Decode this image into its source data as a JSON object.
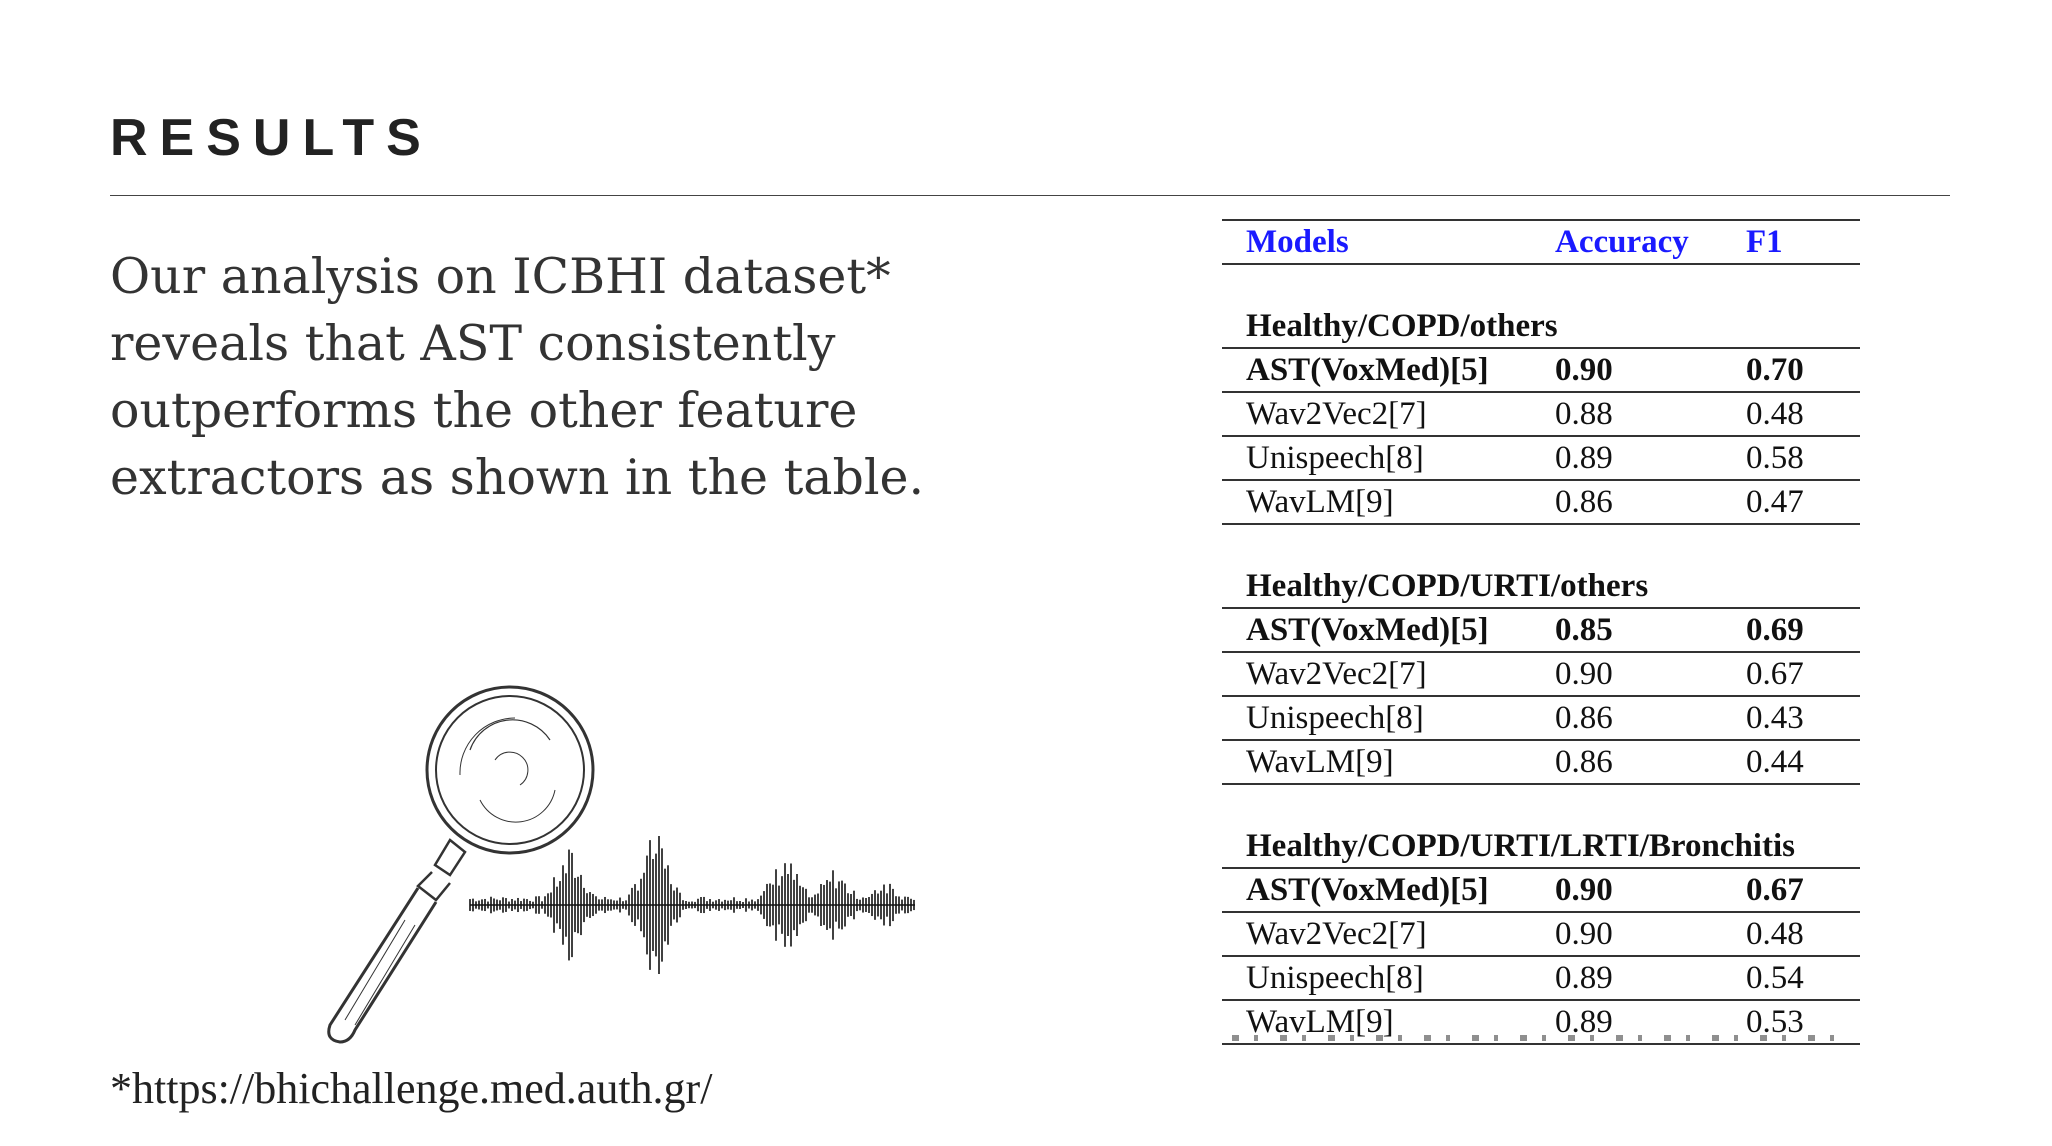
{
  "slide": {
    "title": "RESULTS",
    "body": "Our analysis on ICBHI dataset* reveals that AST consistently outperforms the other feature extractors as shown in the table.",
    "footnote": "*https://bhichallenge.med.auth.gr/"
  },
  "table": {
    "headers": [
      "Models",
      "Accuracy",
      "F1"
    ],
    "header_color": "#1a1aff",
    "groups": [
      {
        "label": "Healthy/COPD/others",
        "rows": [
          {
            "model": "AST(VoxMed)[5]",
            "accuracy": "0.90",
            "f1": "0.70",
            "best": true
          },
          {
            "model": "Wav2Vec2[7]",
            "accuracy": "0.88",
            "f1": "0.48",
            "best": false
          },
          {
            "model": "Unispeech[8]",
            "accuracy": "0.89",
            "f1": "0.58",
            "best": false
          },
          {
            "model": "WavLM[9]",
            "accuracy": "0.86",
            "f1": "0.47",
            "best": false
          }
        ]
      },
      {
        "label": "Healthy/COPD/URTI/others",
        "rows": [
          {
            "model": "AST(VoxMed)[5]",
            "accuracy": "0.85",
            "f1": "0.69",
            "best": true
          },
          {
            "model": "Wav2Vec2[7]",
            "accuracy": "0.90",
            "f1": "0.67",
            "best": false
          },
          {
            "model": "Unispeech[8]",
            "accuracy": "0.86",
            "f1": "0.43",
            "best": false
          },
          {
            "model": "WavLM[9]",
            "accuracy": "0.86",
            "f1": "0.44",
            "best": false
          }
        ]
      },
      {
        "label": "Healthy/COPD/URTI/LRTI/Bronchitis",
        "rows": [
          {
            "model": "AST(VoxMed)[5]",
            "accuracy": "0.90",
            "f1": "0.67",
            "best": true
          },
          {
            "model": "Wav2Vec2[7]",
            "accuracy": "0.90",
            "f1": "0.48",
            "best": false
          },
          {
            "model": "Unispeech[8]",
            "accuracy": "0.89",
            "f1": "0.54",
            "best": false
          },
          {
            "model": "WavLM[9]",
            "accuracy": "0.89",
            "f1": "0.53",
            "best": false
          }
        ]
      }
    ]
  },
  "illustration": {
    "icons": [
      "magnifying-glass-icon",
      "sound-waveform-icon"
    ]
  }
}
